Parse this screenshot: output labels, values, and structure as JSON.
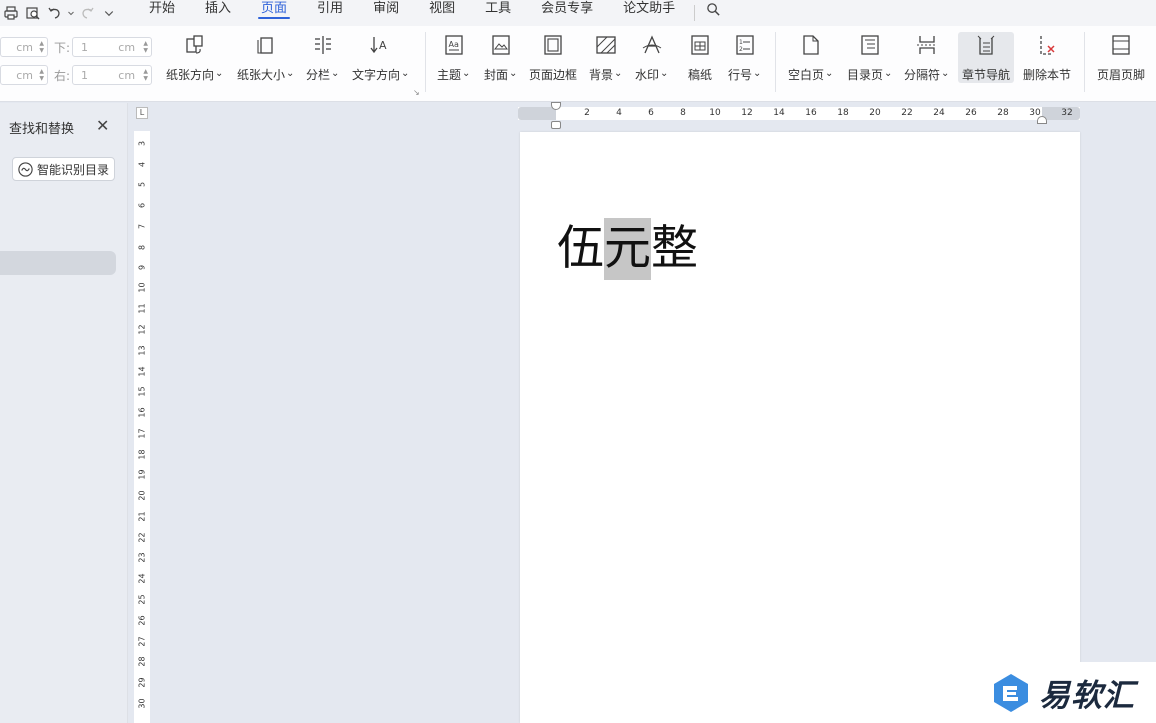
{
  "menubar": {
    "tabs": [
      "开始",
      "插入",
      "页面",
      "引用",
      "审阅",
      "视图",
      "工具",
      "会员专享",
      "论文助手"
    ],
    "active_tab": "页面"
  },
  "ribbon": {
    "margins": {
      "top_value": "",
      "top_unit": "cm",
      "bottom_label": "下:",
      "bottom_value": "1",
      "bottom_unit": "cm",
      "left_value": "",
      "left_unit": "cm",
      "right_label": "右:",
      "right_value": "1",
      "right_unit": "cm"
    },
    "buttons": {
      "orientation": "纸张方向",
      "size": "纸张大小",
      "columns": "分栏",
      "text_direction": "文字方向",
      "theme": "主题",
      "cover": "封面",
      "page_border": "页面边框",
      "background": "背景",
      "watermark": "水印",
      "manuscript": "稿纸",
      "line_number": "行号",
      "blank_page": "空白页",
      "toc_page": "目录页",
      "separator": "分隔符",
      "chapter_nav": "章节导航",
      "delete_section": "删除本节",
      "header_footer": "页眉页脚"
    }
  },
  "find_panel": {
    "title": "查找和替换",
    "smart_button": "智能识别目录"
  },
  "rulers": {
    "horizontal": [
      "2",
      "4",
      "6",
      "8",
      "10",
      "12",
      "14",
      "16",
      "18",
      "20",
      "22",
      "24",
      "26",
      "28",
      "30",
      "32"
    ],
    "vertical": [
      "3",
      "4",
      "5",
      "6",
      "7",
      "8",
      "9",
      "10",
      "11",
      "12",
      "13",
      "14",
      "15",
      "16",
      "17",
      "18",
      "19",
      "20",
      "21",
      "22",
      "23",
      "24",
      "25",
      "26",
      "27",
      "28",
      "29",
      "30"
    ]
  },
  "document": {
    "text_before": "伍",
    "text_selected": "元",
    "text_after": "整"
  },
  "watermark_text": "易软汇",
  "colors": {
    "accent": "#2f62d9",
    "selection": "#c6c6c6",
    "logo": "#3b8de0"
  }
}
